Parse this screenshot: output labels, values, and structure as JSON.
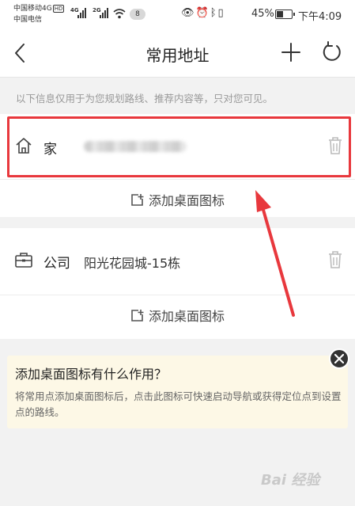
{
  "statusbar": {
    "carrier1": "中国移动4G",
    "carrier1_badge": "HD",
    "carrier2": "中国电信",
    "sig1": "4G",
    "sig2": "2G",
    "notif_count": "8",
    "battery_pct": "45%",
    "battery_level": 0.45,
    "time": "下午4:09"
  },
  "nav": {
    "title": "常用地址",
    "back_icon": "chevron-left-icon",
    "add_icon": "plus-icon",
    "refresh_icon": "refresh-icon"
  },
  "info_text": "以下信息仅用于为您规划路线、推荐内容等，只对您可见。",
  "home": {
    "name": "家",
    "icon": "home-icon",
    "action": "添加桌面图标"
  },
  "company": {
    "name": "公司",
    "address": "阳光花园城-15栋",
    "icon": "briefcase-icon",
    "action": "添加桌面图标"
  },
  "tip": {
    "title": "添加桌面图标有什么作用？",
    "body": "将常用点添加桌面图标后，点击此图标可快速启动导航或获得定位点到设置点的路线。"
  },
  "watermark": "Bai 经验",
  "colors": {
    "highlight": "#e8383d",
    "tip_bg": "#fdf8e6"
  }
}
